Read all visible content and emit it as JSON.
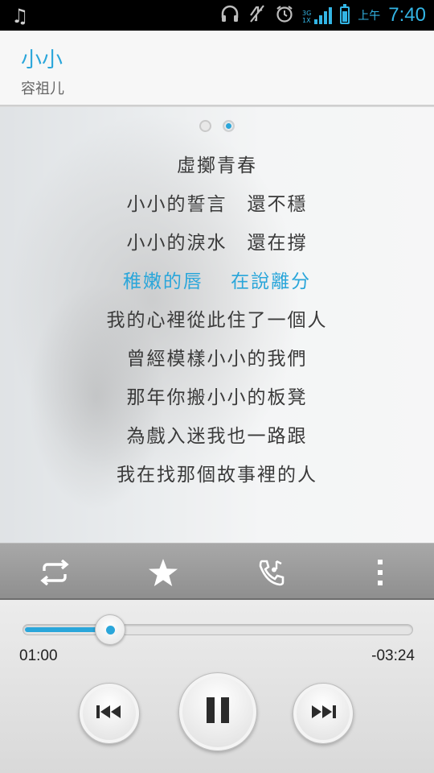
{
  "status_bar": {
    "am_pm": "上午",
    "time": "7:40",
    "network_label_top": "3G",
    "network_label_bottom": "1X",
    "icons": [
      "music-note-icon",
      "headphones-icon",
      "vibrate-off-icon",
      "alarm-icon",
      "signal-icon",
      "battery-icon"
    ]
  },
  "song": {
    "title": "小小",
    "artist": "容祖儿"
  },
  "pager": {
    "count": 2,
    "active_index": 1
  },
  "lyrics": {
    "lines": [
      "虛擲青春",
      "小小的誓言　還不穩",
      "小小的淚水　還在撐",
      "稚嫩的唇　 在說離分",
      "我的心裡從此住了一個人",
      "曾經模樣小小的我們",
      "那年你搬小小的板凳",
      "為戲入迷我也一路跟",
      "我在找那個故事裡的人"
    ],
    "current_index": 3
  },
  "toolbar": {
    "items": [
      "repeat-icon",
      "favorite-star-icon",
      "call-ringtone-icon",
      "more-vert-icon"
    ]
  },
  "playback": {
    "elapsed": "01:00",
    "remaining": "-03:24",
    "progress_fraction": 0.225,
    "state": "playing"
  },
  "colors": {
    "accent": "#2aa6da",
    "lyric_text": "#3a3a3a",
    "status_bar_bg": "#000000",
    "toolbar_bg": "#9e9e9e"
  }
}
